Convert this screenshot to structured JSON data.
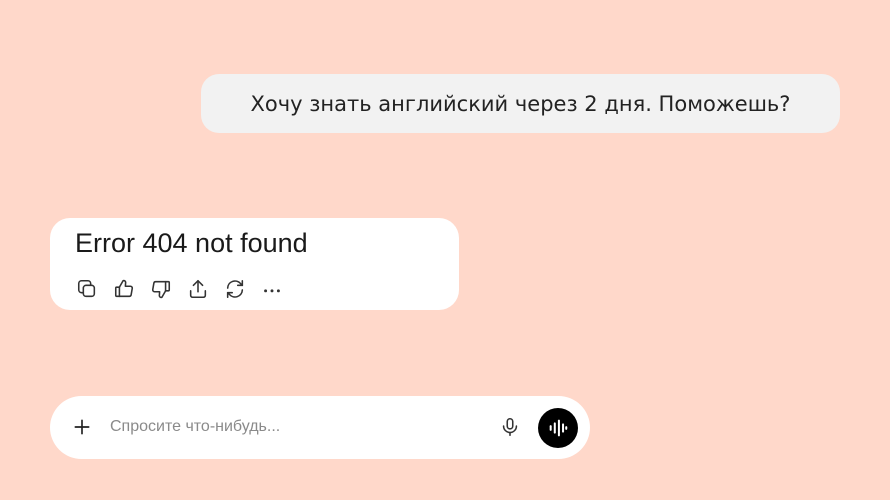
{
  "conversation": {
    "user_message": "Хочу знать английский через 2 дня. Поможешь?",
    "assistant_message": "Error 404 not found",
    "assistant_actions": [
      {
        "name": "copy-icon"
      },
      {
        "name": "thumbs-up-icon"
      },
      {
        "name": "thumbs-down-icon"
      },
      {
        "name": "share-icon"
      },
      {
        "name": "regenerate-icon"
      },
      {
        "name": "more-icon"
      }
    ]
  },
  "composer": {
    "placeholder": "Спросите что-нибудь...",
    "value": "",
    "icons": {
      "attach": "plus-icon",
      "dictate": "microphone-icon",
      "voice_mode": "voice-waveform-icon"
    }
  },
  "colors": {
    "background": "#FFD8CA",
    "user_bubble": "#F2F2F2",
    "assistant_bubble": "#FFFFFF",
    "voice_button": "#000000"
  }
}
